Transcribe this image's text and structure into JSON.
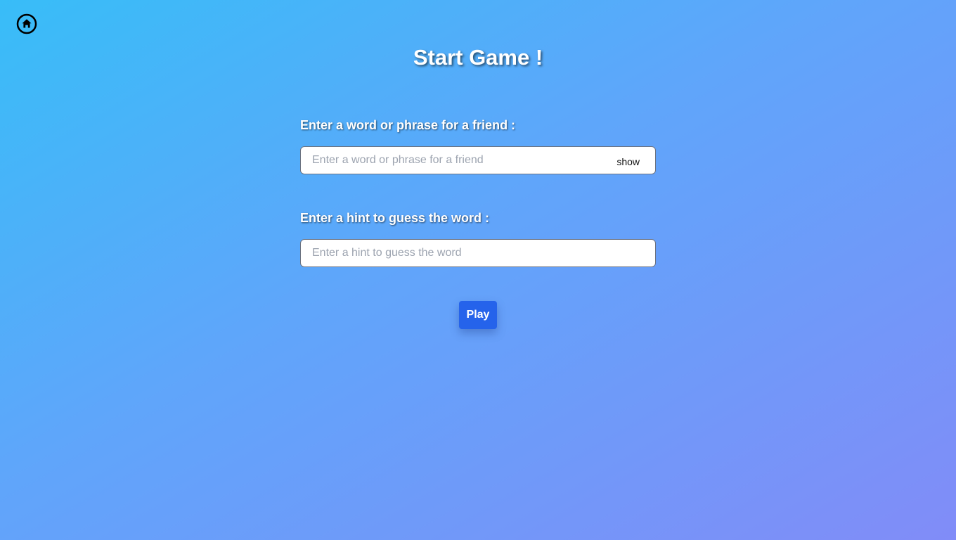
{
  "nav": {
    "home_icon": "home-icon"
  },
  "page": {
    "title": "Start Game !"
  },
  "form": {
    "word": {
      "label": "Enter a word or phrase for a friend :",
      "placeholder": "Enter a word or phrase for a friend",
      "value": "",
      "toggle_label": "show"
    },
    "hint": {
      "label": "Enter a hint to guess the word :",
      "placeholder": "Enter a hint to guess the word",
      "value": ""
    },
    "play_label": "Play"
  },
  "colors": {
    "background_start": "#38bdf8",
    "background_end": "#818cf8",
    "play_button": "#2563eb",
    "text": "#ffffff"
  }
}
